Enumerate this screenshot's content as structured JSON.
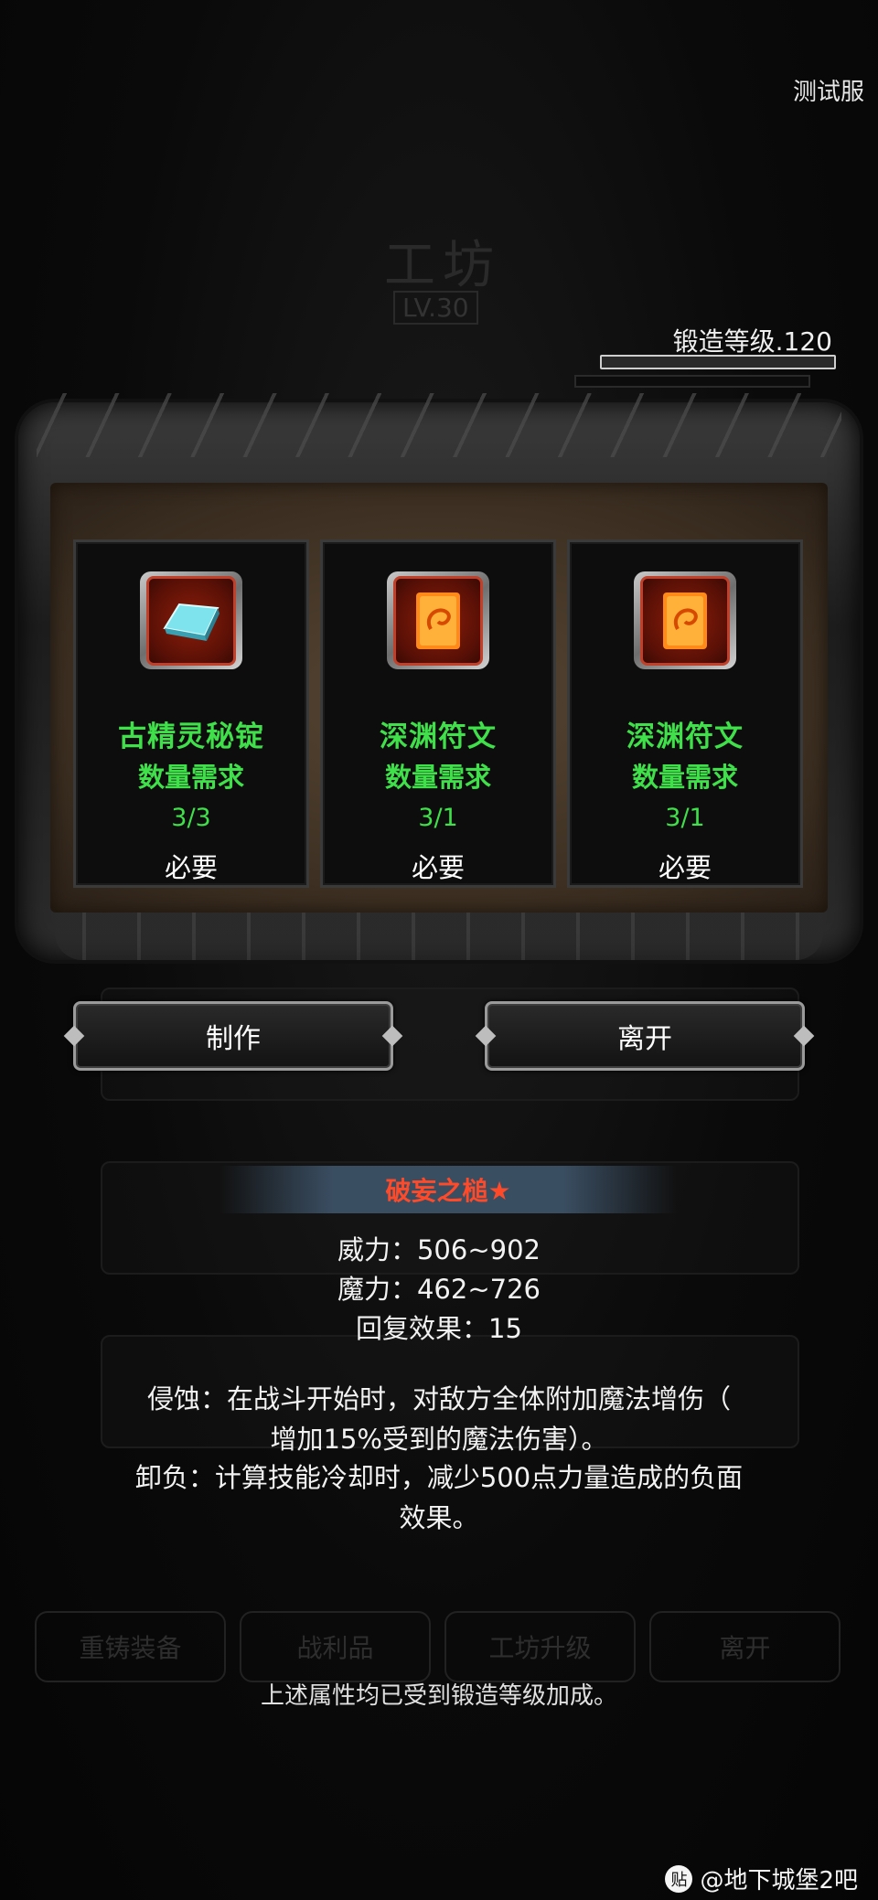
{
  "server_label": "测试服",
  "forge": {
    "level_text": "锻造等级.120",
    "bar_fraction": 1.0
  },
  "background": {
    "workshop_title": "工坊",
    "workshop_level": "LV.30",
    "buttons": [
      "重铸装备",
      "战利品",
      "工坊升级",
      "离开"
    ]
  },
  "materials": [
    {
      "name": "古精灵秘锭",
      "requirement_label": "数量需求",
      "count": "3/3",
      "necessity": "必要",
      "icon": "silver-ingot-icon"
    },
    {
      "name": "深渊符文",
      "requirement_label": "数量需求",
      "count": "3/1",
      "necessity": "必要",
      "icon": "abyss-rune-icon"
    },
    {
      "name": "深渊符文",
      "requirement_label": "数量需求",
      "count": "3/1",
      "necessity": "必要",
      "icon": "abyss-rune-icon"
    }
  ],
  "actions": {
    "craft_label": "制作",
    "leave_label": "离开"
  },
  "tooltip": {
    "item_name": "破妄之槌",
    "star": "★",
    "power": "威力：506~902",
    "magic": "魔力：462~726",
    "recovery": "回复效果：15",
    "effect1_line1": "侵蚀：在战斗开始时，对敌方全体附加魔法增伤（",
    "effect1_line2": "增加15%受到的魔法伤害）。",
    "effect2_line1": "卸负：计算技能冷却时，减少500点力量造成的负面",
    "effect2_line2": "效果。",
    "footer": "上述属性均已受到锻造等级加成。"
  },
  "watermark": {
    "badge": "贴",
    "text": "@地下城堡2吧"
  },
  "colors": {
    "material_text": "#3fe04a",
    "item_name": "#ff4a2a",
    "tooltip_header_bg": "#3a4e62"
  }
}
